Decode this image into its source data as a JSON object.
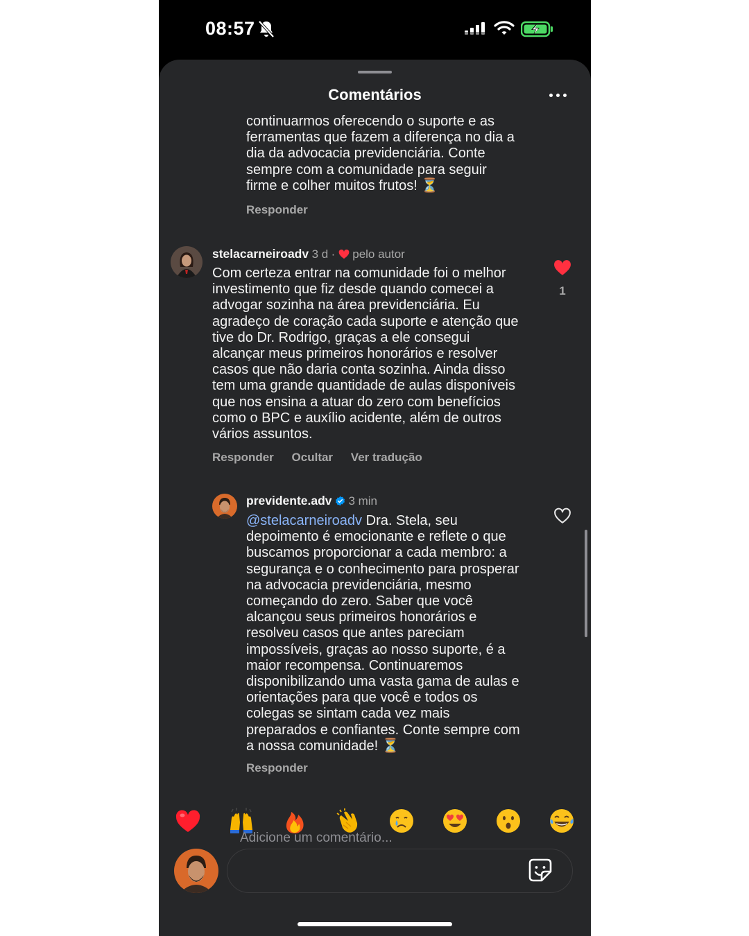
{
  "status_bar": {
    "time": "08:57"
  },
  "header": {
    "title": "Comentários"
  },
  "comments": [
    {
      "lines": [
        "continuarmos oferecendo o suporte e as",
        "ferramentas que fazem a diferença no dia a",
        "dia da advocacia previdenciária. Conte",
        "sempre com a comunidade para seguir",
        "firme e colher muitos frutos! ⏳"
      ],
      "reply_label": "Responder"
    },
    {
      "username": "stelacarneiroadv",
      "time": "3 d",
      "separator": "·",
      "liked_by_author": "pelo autor",
      "lines": [
        "Com certeza entrar na comunidade foi o melhor",
        "investimento que fiz desde quando comecei a",
        "advogar sozinha na área previdenciária. Eu",
        "agradeço de coração cada suporte e atenção que",
        "tive do Dr. Rodrigo, graças a ele consegui",
        "alcançar meus primeiros honorários e resolver",
        "casos que não daria conta sozinha. Ainda disso",
        "tem uma grande quantidade de aulas disponíveis",
        "que nos ensina a atuar do zero com benefícios",
        "como o BPC e auxílio acidente, além de outros",
        "vários assuntos."
      ],
      "actions": [
        "Responder",
        "Ocultar",
        "Ver tradução"
      ],
      "like_count": "1",
      "liked": true
    },
    {
      "username": "previdente.adv",
      "verified": true,
      "time": "3 min",
      "mention": "@stelacarneiroadv",
      "lines": [
        " Dra. Stela, seu",
        "depoimento é emocionante e reflete o que",
        "buscamos proporcionar a cada membro: a",
        "segurança e o conhecimento para prosperar",
        "na advocacia previdenciária, mesmo",
        "começando do zero. Saber que você",
        "alcançou seus primeiros honorários e",
        "resolveu casos que antes pareciam",
        "impossíveis, graças ao nosso suporte, é a",
        "maior recompensa. Continuaremos",
        "disponibilizando uma vasta gama de aulas e",
        "orientações para que você e todos os",
        "colegas se sintam cada vez mais",
        "preparados e confiantes. Conte sempre com",
        "a nossa comunidade! ⏳"
      ],
      "reply_label": "Responder",
      "liked": false
    }
  ],
  "reactions": [
    "❤️",
    "🙌",
    "🔥",
    "👏",
    "😢",
    "😍",
    "😮",
    "😂"
  ],
  "composer": {
    "placeholder": "Adicione um comentário..."
  },
  "colors": {
    "sheet_bg": "#262729",
    "like_red": "#ff3040",
    "mention_blue": "#8ab4f8",
    "verified_blue": "#0095f6",
    "secondary_text": "#a8a8a8"
  },
  "icons": [
    "bell-slash-icon",
    "signal-icon",
    "wifi-icon",
    "battery-charging-icon",
    "more-icon",
    "heart-filled-icon",
    "heart-outline-icon",
    "verified-badge-icon",
    "sticker-icon"
  ]
}
